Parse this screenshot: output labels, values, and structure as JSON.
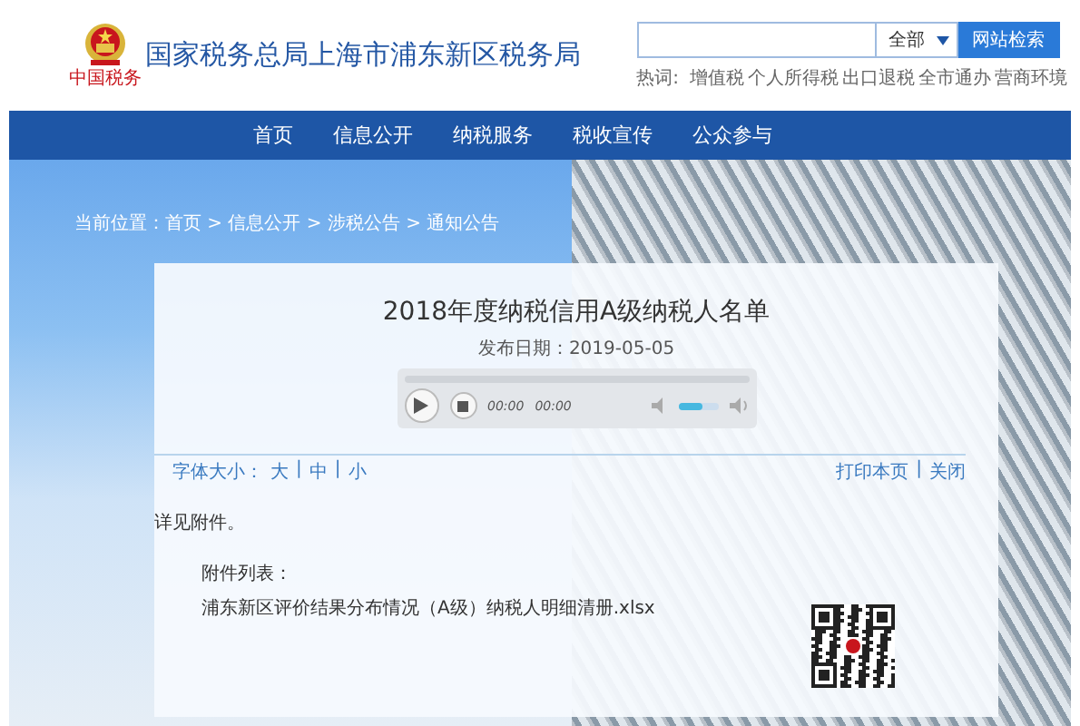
{
  "header": {
    "logo_text": "中国税务",
    "title": "国家税务总局上海市浦东新区税务局"
  },
  "search": {
    "scope": "全部",
    "button": "网站检索",
    "hot_label": "热词:",
    "hot_words": [
      "增值税",
      "个人所得税",
      "出口退税",
      "全市通办",
      "营商环境"
    ]
  },
  "nav": [
    {
      "label": "首页"
    },
    {
      "label": "信息公开"
    },
    {
      "label": "纳税服务"
    },
    {
      "label": "税收宣传"
    },
    {
      "label": "公众参与"
    }
  ],
  "breadcrumb": "当前位置：首页 > 信息公开 > 涉税公告 > 通知公告",
  "article": {
    "title": "2018年度纳税信用A级纳税人名单",
    "date": "发布日期：2019-05-05",
    "player": {
      "time_current": "00:00",
      "time_total": "00:00",
      "volume": {
        "level": 0.6
      }
    },
    "font_size": {
      "label": "字体大小：",
      "options": [
        "大",
        "中",
        "小"
      ],
      "separators": [
        "|",
        "|"
      ]
    },
    "actions": [
      "打印本页",
      "关闭"
    ],
    "action_separator": "|",
    "body": "详见附件。",
    "attachments_label": "附件列表：",
    "attachments": [
      "浦东新区评价结果分布情况（A级）纳税人明细清册.xlsx"
    ]
  }
}
